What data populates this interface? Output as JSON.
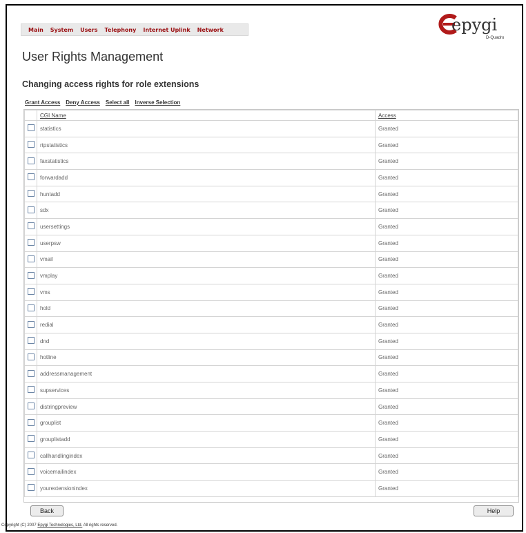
{
  "menu": {
    "items": [
      "Main",
      "System",
      "Users",
      "Telephony",
      "Internet Uplink",
      "Network"
    ]
  },
  "logo": {
    "word": "epygi",
    "sub": "D-Quadro"
  },
  "page": {
    "title": "User Rights Management",
    "subtitle": "Changing access rights for role extensions"
  },
  "toolbar": {
    "grant": "Grant Access",
    "deny": "Deny Access",
    "select_all": "Select all",
    "inverse": "Inverse Selection"
  },
  "table": {
    "headers": {
      "cgi": "CGI Name",
      "access": "Access"
    },
    "rows": [
      {
        "name": "statistics",
        "access": "Granted"
      },
      {
        "name": "rtpstatistics",
        "access": "Granted"
      },
      {
        "name": "faxstatistics",
        "access": "Granted"
      },
      {
        "name": "forwardadd",
        "access": "Granted"
      },
      {
        "name": "huntadd",
        "access": "Granted"
      },
      {
        "name": "sdx",
        "access": "Granted"
      },
      {
        "name": "usersettings",
        "access": "Granted"
      },
      {
        "name": "userpsw",
        "access": "Granted"
      },
      {
        "name": "vmail",
        "access": "Granted"
      },
      {
        "name": "vmplay",
        "access": "Granted"
      },
      {
        "name": "vms",
        "access": "Granted"
      },
      {
        "name": "hold",
        "access": "Granted"
      },
      {
        "name": "redial",
        "access": "Granted"
      },
      {
        "name": "dnd",
        "access": "Granted"
      },
      {
        "name": "hotline",
        "access": "Granted"
      },
      {
        "name": "addressmanagement",
        "access": "Granted"
      },
      {
        "name": "supservices",
        "access": "Granted"
      },
      {
        "name": "distringpreview",
        "access": "Granted"
      },
      {
        "name": "grouplist",
        "access": "Granted"
      },
      {
        "name": "grouplistadd",
        "access": "Granted"
      },
      {
        "name": "callhandlingindex",
        "access": "Granted"
      },
      {
        "name": "voicemailindex",
        "access": "Granted"
      },
      {
        "name": "yourextensionindex",
        "access": "Granted"
      }
    ]
  },
  "buttons": {
    "back": "Back",
    "help": "Help"
  },
  "footer": {
    "prefix": "Copyright (C) 2007 ",
    "company": "Epygi Technologies, Ltd.",
    "suffix": " All rights reserved."
  },
  "colors": {
    "menu_text": "#9b0f12",
    "logo_e": "#b11a1a",
    "checkbox_border": "#6c86a6"
  }
}
